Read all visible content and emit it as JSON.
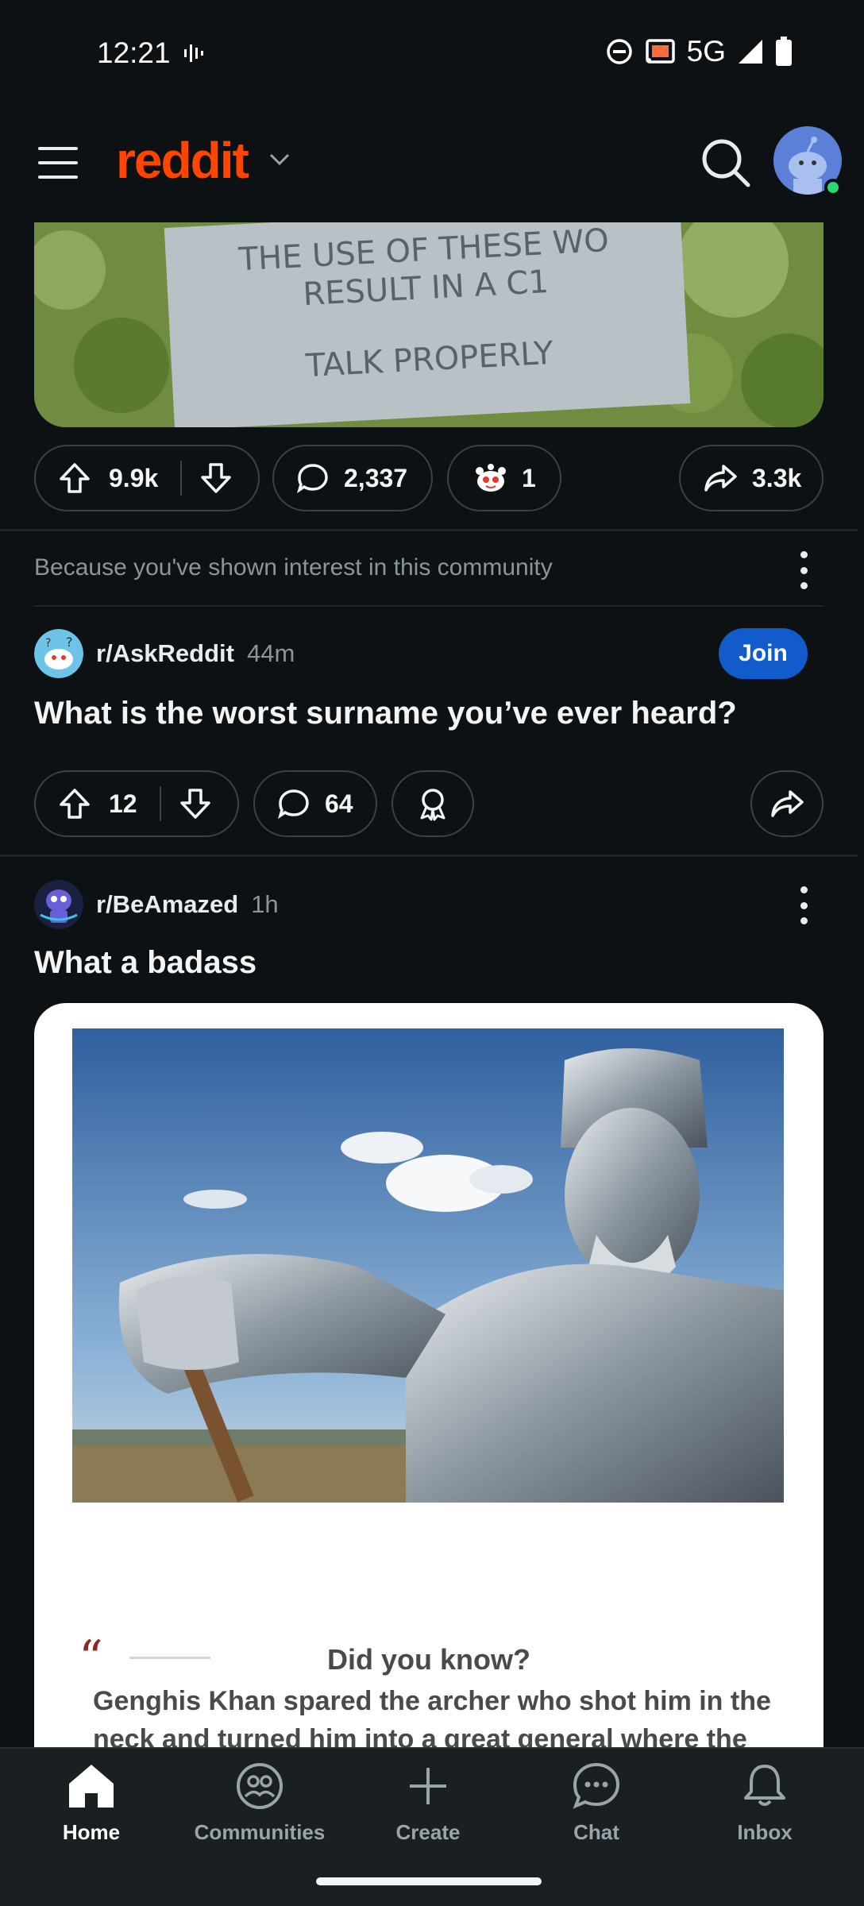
{
  "status_bar": {
    "time": "12:21",
    "network": "5G"
  },
  "header": {
    "logo": "reddit"
  },
  "top_post": {
    "sign_lines": [
      "THE USE OF THESE WO",
      "RESULT IN A C1",
      "TALK PROPERLY"
    ],
    "upvotes": "9.9k",
    "comments": "2,337",
    "awards": "1",
    "shares": "3.3k"
  },
  "recommendation": {
    "text": "Because you've shown interest in this community"
  },
  "askreddit_post": {
    "subreddit": "r/AskReddit",
    "time": "44m",
    "join_label": "Join",
    "title": "What is the worst surname you’ve ever heard?",
    "upvotes": "12",
    "comments": "64"
  },
  "beamazed_post": {
    "subreddit": "r/BeAmazed",
    "time": "1h",
    "title": "What a badass",
    "dyk_title": "Did you know?",
    "dyk_line1": "Genghis Khan spared the archer who shot him in the",
    "dyk_line2": "neck and turned him into a great general where the"
  },
  "bottom_nav": {
    "items": [
      {
        "label": "Home",
        "icon": "home-icon"
      },
      {
        "label": "Communities",
        "icon": "communities-icon"
      },
      {
        "label": "Create",
        "icon": "plus-icon"
      },
      {
        "label": "Chat",
        "icon": "chat-icon"
      },
      {
        "label": "Inbox",
        "icon": "bell-icon"
      }
    ]
  },
  "colors": {
    "accent": "#ff4500",
    "join": "#115bca",
    "background": "#0e1113"
  }
}
